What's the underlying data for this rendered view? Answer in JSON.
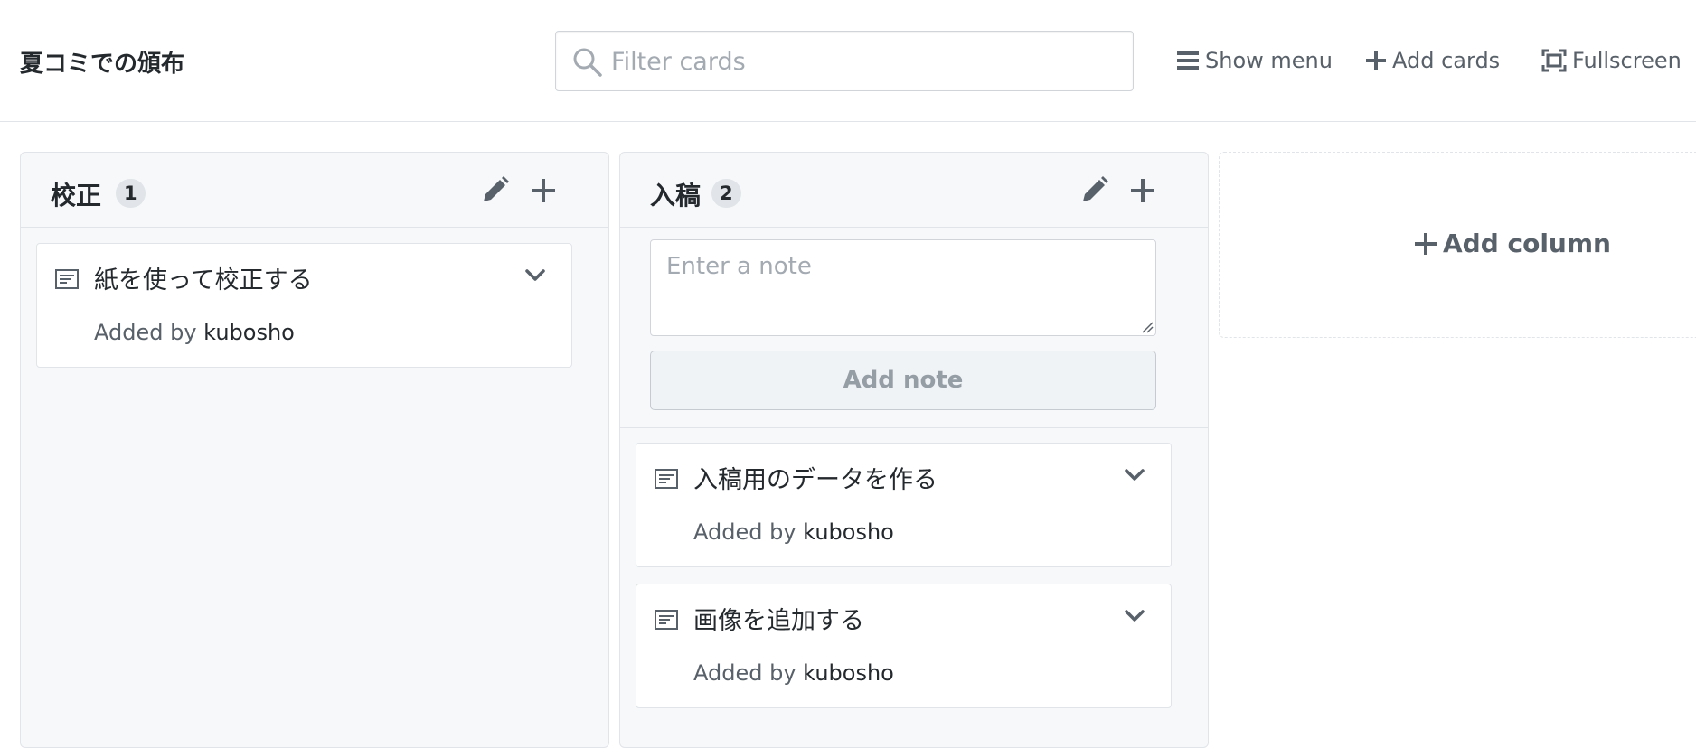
{
  "header": {
    "project_title": "夏コミでの頒布",
    "filter_placeholder": "Filter cards",
    "show_menu_label": "Show menu",
    "add_cards_label": "Add cards",
    "fullscreen_label": "Fullscreen"
  },
  "columns": [
    {
      "title": "校正",
      "count": "1",
      "cards": [
        {
          "title": "紙を使って校正する",
          "added_by_label": "Added by",
          "author": "kubosho"
        }
      ]
    },
    {
      "title": "入稿",
      "count": "2",
      "note_placeholder": "Enter a note",
      "add_note_label": "Add note",
      "cards": [
        {
          "title": "入稿用のデータを作る",
          "added_by_label": "Added by",
          "author": "kubosho"
        },
        {
          "title": "画像を追加する",
          "added_by_label": "Added by",
          "author": "kubosho"
        }
      ]
    }
  ],
  "add_column_label": "Add column",
  "colors": {
    "text": "#24292e",
    "muted": "#586069",
    "border": "#e1e4e8",
    "column_bg": "#f6f8fa"
  }
}
